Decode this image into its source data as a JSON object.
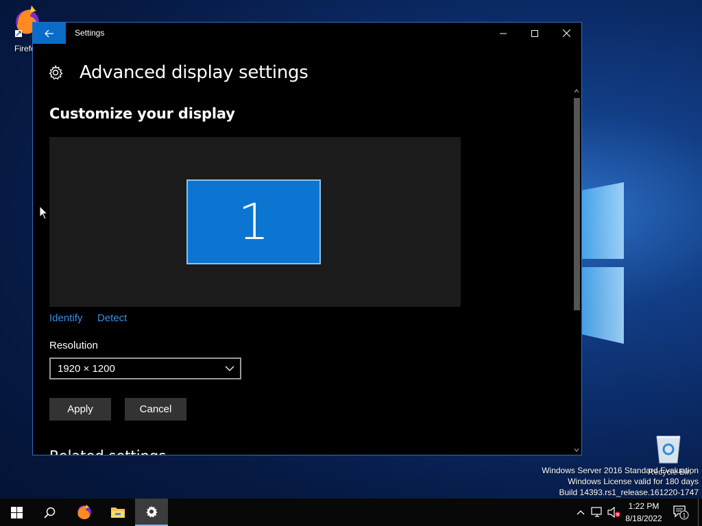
{
  "desktop": {
    "icons": [
      {
        "label": "Firefox"
      },
      {
        "label": "Recycle Bin"
      }
    ],
    "watermark": {
      "line1": "Windows Server 2016 Standard Evaluation",
      "line2": "Windows License valid for 180 days",
      "line3": "Build 14393.rs1_release.161220-1747"
    }
  },
  "window": {
    "title": "Settings",
    "page_title": "Advanced display settings",
    "section_title": "Customize your display",
    "monitor_number": "1",
    "links": {
      "identify": "Identify",
      "detect": "Detect"
    },
    "resolution": {
      "label": "Resolution",
      "value": "1920 × 1200"
    },
    "buttons": {
      "apply": "Apply",
      "cancel": "Cancel"
    },
    "next_section_partial": "Related settings"
  },
  "taskbar": {
    "clock_time": "1:22 PM",
    "clock_date": "8/18/2022",
    "notification_count": "1"
  },
  "colors": {
    "accent": "#0a6cc9",
    "link": "#3a8ee6",
    "monitor_fill": "#0b75d1"
  }
}
